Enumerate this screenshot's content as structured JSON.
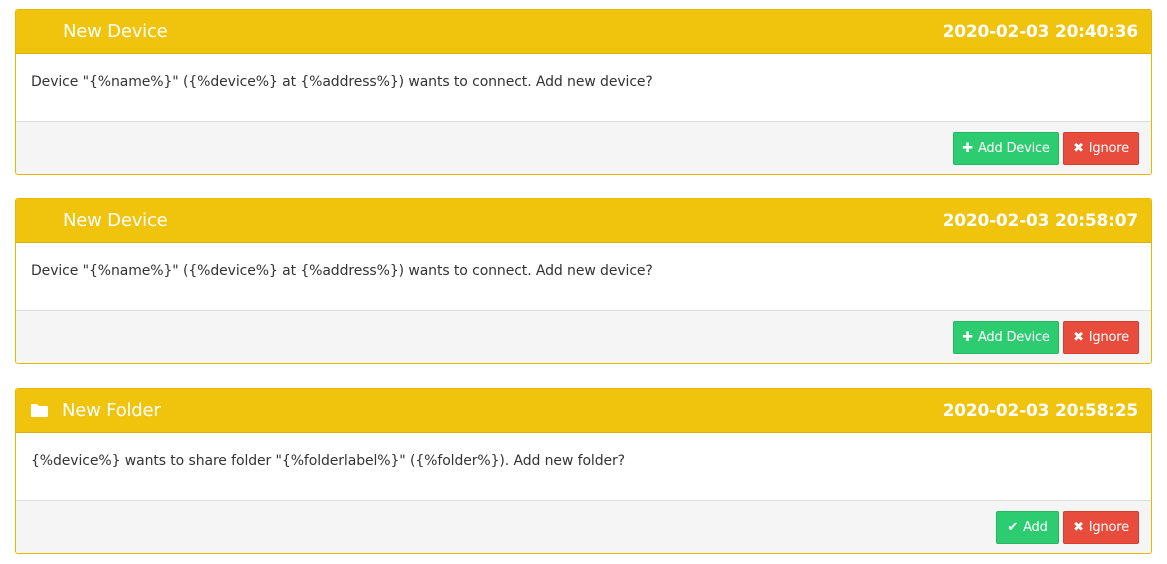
{
  "notifications": [
    {
      "title": "New Device",
      "timestamp": "2020-02-03 20:40:36",
      "message": "Device \"{%name%}\" ({%device%} at {%address%}) wants to connect. Add new device?",
      "primary_label": "Add Device",
      "primary_icon": "plus-icon",
      "ignore_label": "Ignore",
      "ignore_icon": "times-icon"
    },
    {
      "title": "New Device",
      "timestamp": "2020-02-03 20:58:07",
      "message": "Device \"{%name%}\" ({%device%} at {%address%}) wants to connect. Add new device?",
      "primary_label": "Add Device",
      "primary_icon": "plus-icon",
      "ignore_label": "Ignore",
      "ignore_icon": "times-icon"
    },
    {
      "title": "New Folder",
      "title_icon": "folder-icon",
      "timestamp": "2020-02-03 20:58:25",
      "message": "{%device%} wants to share folder \"{%folderlabel%}\" ({%folder%}). Add new folder?",
      "primary_label": "Add",
      "primary_icon": "check-icon",
      "ignore_label": "Ignore",
      "ignore_icon": "times-icon"
    }
  ],
  "colors": {
    "heading": "#f0c40c",
    "success": "#2ecc71",
    "danger": "#e74c3c",
    "footer": "#f5f5f5"
  }
}
